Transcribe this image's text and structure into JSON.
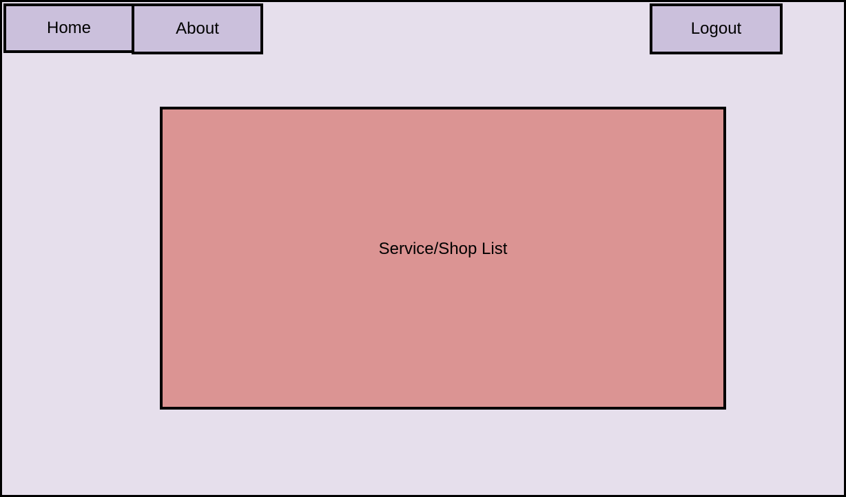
{
  "nav": {
    "home_label": "Home",
    "about_label": "About",
    "logout_label": "Logout"
  },
  "main": {
    "panel_label": "Service/Shop List"
  },
  "colors": {
    "background": "#e6dfec",
    "nav_button": "#cbc0dc",
    "panel": "#db9493",
    "border": "#000000"
  }
}
